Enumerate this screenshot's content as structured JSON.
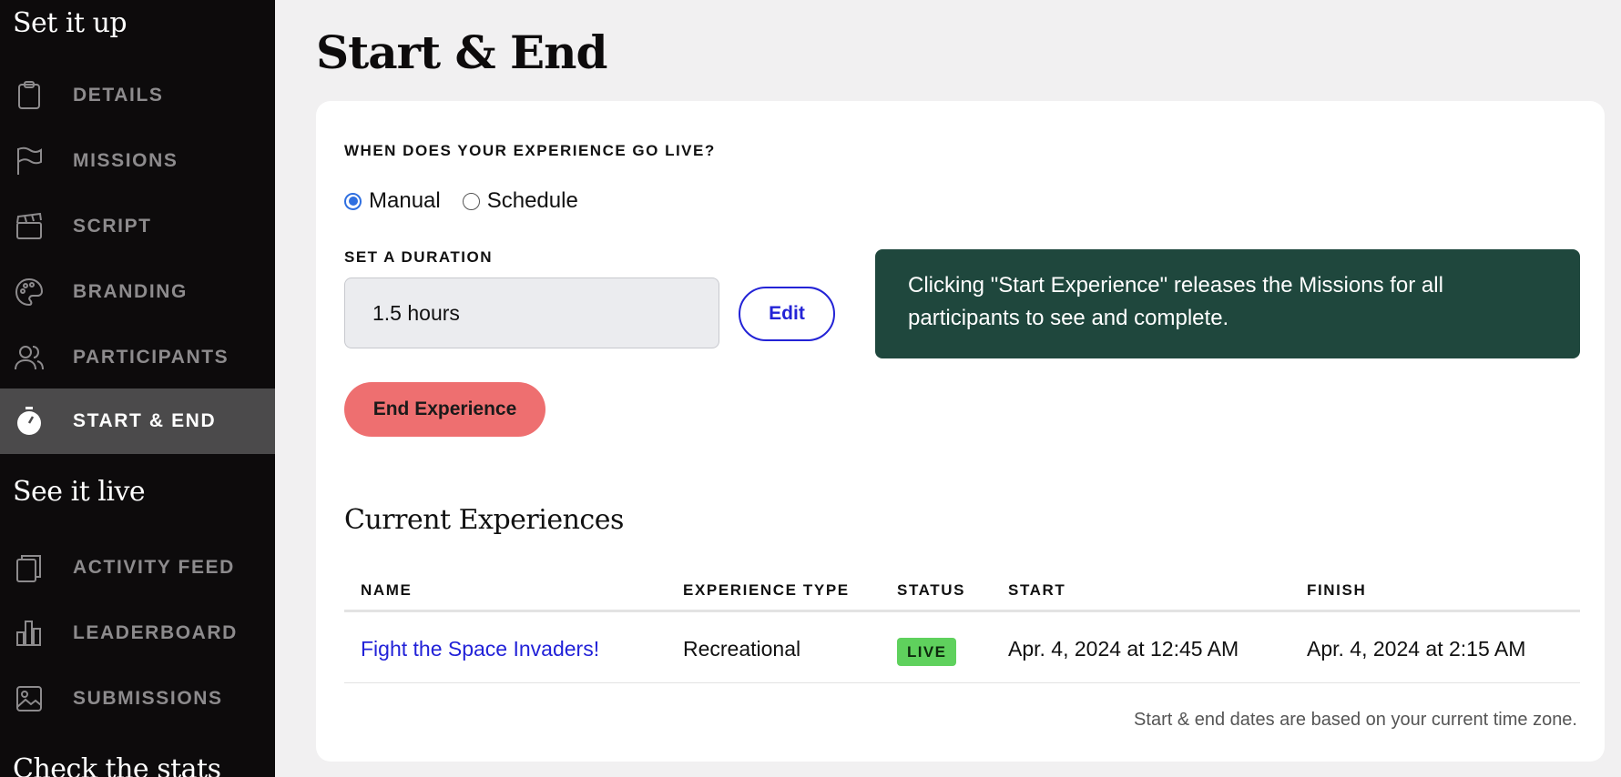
{
  "sidebar": {
    "section_setup": "Set it up",
    "section_live": "See it live",
    "section_stats": "Check the stats",
    "items": [
      {
        "label": "DETAILS",
        "icon": "clipboard-icon"
      },
      {
        "label": "MISSIONS",
        "icon": "flag-icon"
      },
      {
        "label": "SCRIPT",
        "icon": "clapperboard-icon"
      },
      {
        "label": "BRANDING",
        "icon": "palette-icon"
      },
      {
        "label": "PARTICIPANTS",
        "icon": "users-icon"
      },
      {
        "label": "START & END",
        "icon": "stopwatch-icon",
        "active": true
      },
      {
        "label": "ACTIVITY FEED",
        "icon": "feed-icon"
      },
      {
        "label": "LEADERBOARD",
        "icon": "bar-chart-icon"
      },
      {
        "label": "SUBMISSIONS",
        "icon": "image-icon"
      }
    ]
  },
  "page": {
    "title": "Start & End"
  },
  "go_live": {
    "label": "WHEN DOES YOUR EXPERIENCE GO LIVE?",
    "options": [
      "Manual",
      "Schedule"
    ],
    "selected": "Manual"
  },
  "duration": {
    "label": "SET A DURATION",
    "value": "1.5 hours",
    "edit_label": "Edit"
  },
  "info": {
    "text": "Clicking \"Start Experience\" releases the Missions for all participants to see and complete."
  },
  "end_button": "End Experience",
  "current": {
    "heading": "Current Experiences",
    "columns": [
      "NAME",
      "EXPERIENCE TYPE",
      "STATUS",
      "START",
      "FINISH"
    ],
    "rows": [
      {
        "name": "Fight the Space Invaders!",
        "type": "Recreational",
        "status": "LIVE",
        "start": "Apr. 4, 2024 at 12:45 AM",
        "finish": "Apr. 4, 2024 at 2:15 AM"
      }
    ],
    "footnote": "Start & end dates are based on your current time zone."
  },
  "colors": {
    "sidebar_bg": "#0d0b0c",
    "active_bg": "#4b4a4b",
    "info_bg": "#1f473d",
    "end_button": "#ee6f70",
    "link": "#2222d8",
    "live_badge": "#5fd15d"
  }
}
